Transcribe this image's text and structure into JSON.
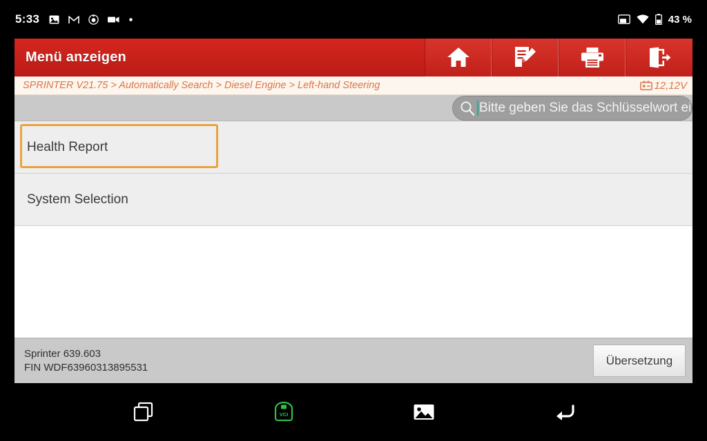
{
  "statusbar": {
    "clock": "5:33",
    "battery_percent": "43 %",
    "left_icons": [
      "screenshot-icon",
      "gmail-icon",
      "app-circle-icon",
      "video-icon",
      "dot-icon"
    ],
    "right_icons": [
      "cast-icon",
      "wifi-icon",
      "battery-icon"
    ]
  },
  "titlebar": {
    "title": "Menü anzeigen",
    "buttons": [
      {
        "name": "home-button",
        "icon": "home-icon"
      },
      {
        "name": "report-button",
        "icon": "edit-report-icon"
      },
      {
        "name": "print-button",
        "icon": "printer-icon"
      },
      {
        "name": "exit-button",
        "icon": "exit-icon"
      }
    ]
  },
  "breadcrumb": {
    "text": "SPRINTER V21.75 > Automatically Search > Diesel Engine > Left-hand Steering",
    "voltage": "12,12V",
    "voltage_icon": "battery-voltage-icon",
    "accent_color": "#d9764a"
  },
  "search": {
    "placeholder": "Bitte geben Sie das Schlüsselwort ein",
    "value": "",
    "icon": "search-icon",
    "caret_color": "#12b4a0"
  },
  "menu": {
    "items": [
      {
        "label": "Health Report",
        "selected": true
      },
      {
        "label": "System Selection",
        "selected": false
      }
    ],
    "selection_color": "#e8a33d"
  },
  "footer": {
    "vehicle_model": "Sprinter 639.603",
    "vin": "FIN WDF63960313895531",
    "translate_label": "Übersetzung"
  },
  "navbar": {
    "items": [
      {
        "name": "recent-apps-button",
        "icon": "recent-apps-icon",
        "color": "#ffffff"
      },
      {
        "name": "vci-button",
        "icon": "vci-connector-icon",
        "label": "VCI",
        "color": "#2fbf4a"
      },
      {
        "name": "gallery-button",
        "icon": "image-icon",
        "color": "#ffffff"
      },
      {
        "name": "back-button",
        "icon": "back-arrow-icon",
        "color": "#ffffff"
      }
    ]
  }
}
